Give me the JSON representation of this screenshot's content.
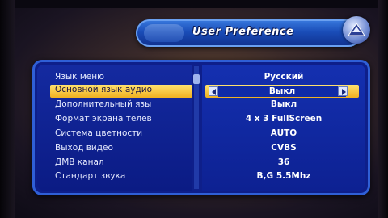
{
  "header": {
    "title": "User Preference"
  },
  "menu": {
    "items": [
      {
        "label": "Язык меню",
        "value": "Русский"
      },
      {
        "label": "Основной язык аудио",
        "value": "Выкл"
      },
      {
        "label": "Дополнительный язы",
        "value": "Выкл"
      },
      {
        "label": "Формат экрана телев",
        "value": "4 x 3 FullScreen"
      },
      {
        "label": "Система цветности",
        "value": "AUTO"
      },
      {
        "label": "Выход видео",
        "value": "CVBS"
      },
      {
        "label": "ДМВ канал",
        "value": "36"
      },
      {
        "label": "Стандарт звука",
        "value": "B,G 5.5Mhz"
      }
    ],
    "selected_index": 1
  },
  "icons": {
    "left_arrow": "arrow-left-icon",
    "right_arrow": "arrow-right-icon",
    "badge": "settings-badge-icon"
  },
  "colors": {
    "panel": "#0e1f8a",
    "highlight": "#f0b020",
    "title_bar": "#1a4db8"
  }
}
